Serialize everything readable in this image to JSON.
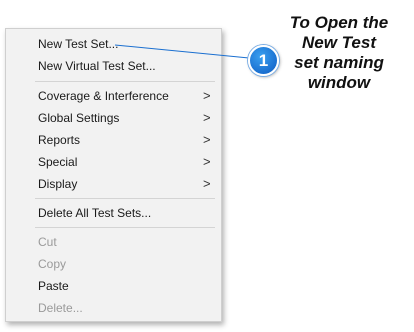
{
  "menu": {
    "new_test_set": "New Test Set...",
    "new_virtual_test_set": "New Virtual Test Set...",
    "coverage_interference": "Coverage & Interference",
    "global_settings": "Global Settings",
    "reports": "Reports",
    "special": "Special",
    "display": "Display",
    "delete_all_test_sets": "Delete All Test Sets...",
    "cut": "Cut",
    "copy": "Copy",
    "paste": "Paste",
    "delete": "Delete...",
    "submenu_arrow": ">"
  },
  "callout": {
    "number": "1",
    "note_lines": [
      "To Open the",
      "New Test",
      "set naming",
      "window"
    ],
    "accent_color": "#1a6fd0"
  }
}
